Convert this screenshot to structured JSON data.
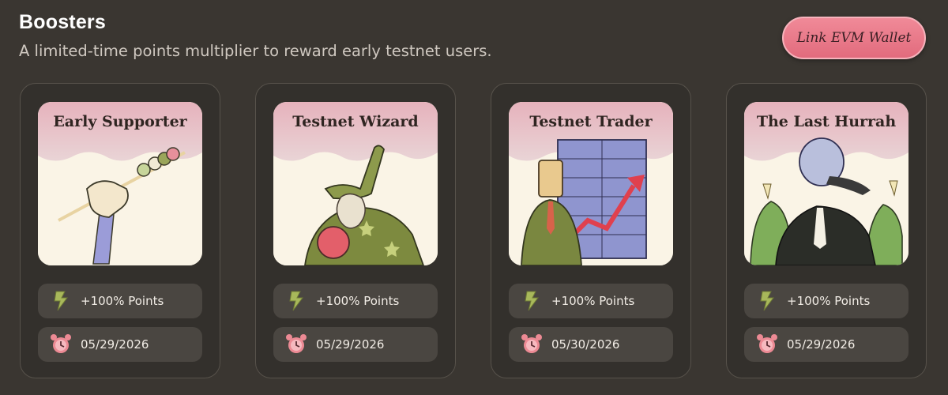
{
  "header": {
    "title": "Boosters",
    "subtitle": "A limited-time points multiplier to reward early testnet users."
  },
  "wallet_button": {
    "label": "Link EVM Wallet"
  },
  "colors": {
    "background": "#3a3631",
    "card": "#33302c",
    "pill": "#4a4641",
    "accent_pink": "#e8798a",
    "bolt_green": "#a8b85a",
    "clock_pink": "#ec8a94"
  },
  "cards": [
    {
      "title": "Early Supporter",
      "points": "+100% Points",
      "date": "05/29/2026",
      "art_icon": "hand-with-skewer-illustration"
    },
    {
      "title": "Testnet Wizard",
      "points": "+100% Points",
      "date": "05/29/2026",
      "art_icon": "wizard-with-apple-illustration"
    },
    {
      "title": "Testnet Trader",
      "points": "+100% Points",
      "date": "05/30/2026",
      "art_icon": "trader-with-chart-illustration"
    },
    {
      "title": "The Last Hurrah",
      "points": "+100% Points",
      "date": "05/29/2026",
      "art_icon": "party-creatures-illustration"
    }
  ]
}
